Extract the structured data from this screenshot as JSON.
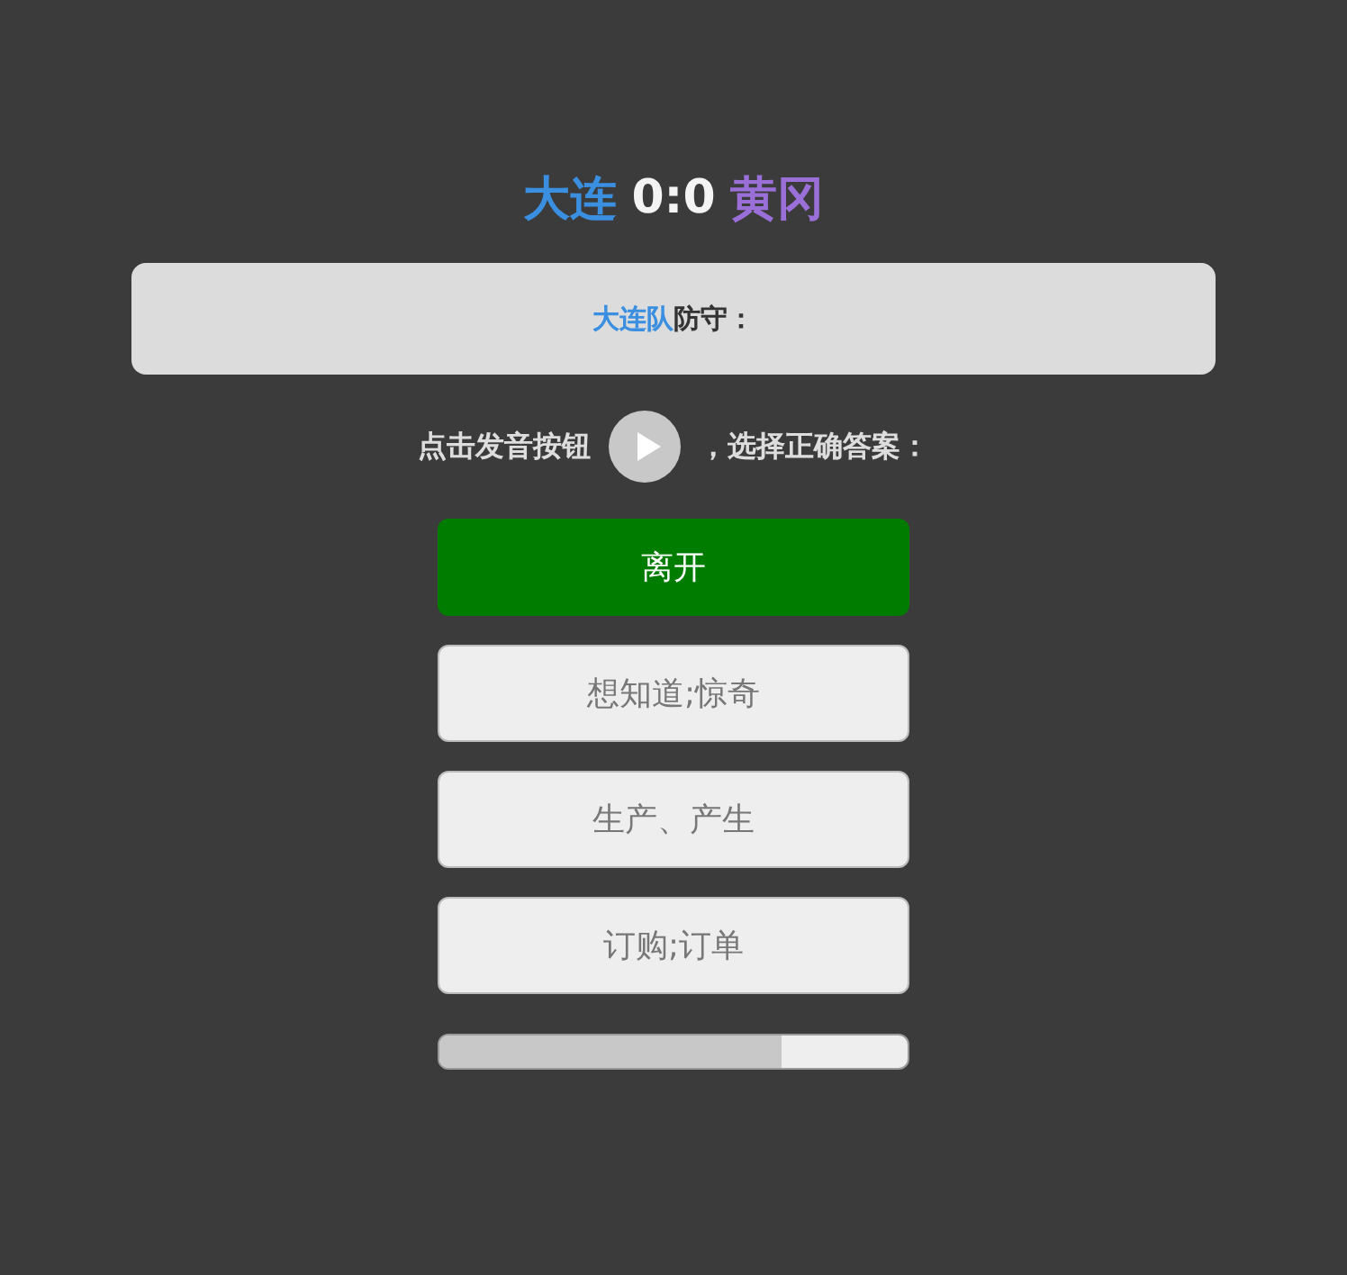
{
  "teams": [
    {
      "name": "大连",
      "color": "#3a8fe0"
    },
    {
      "name": "黄冈",
      "color": "#9b6fd8"
    }
  ],
  "score": "0:0",
  "defense": {
    "team": "大连队",
    "label": "防守："
  },
  "prompt": {
    "before": "点击发音按钮",
    "after": "，选择正确答案："
  },
  "options": [
    {
      "label": "离开",
      "selected": true
    },
    {
      "label": "想知道;惊奇",
      "selected": false
    },
    {
      "label": "生产、产生",
      "selected": false
    },
    {
      "label": "订购;订单",
      "selected": false
    }
  ],
  "progress": {
    "level": 0.73
  }
}
